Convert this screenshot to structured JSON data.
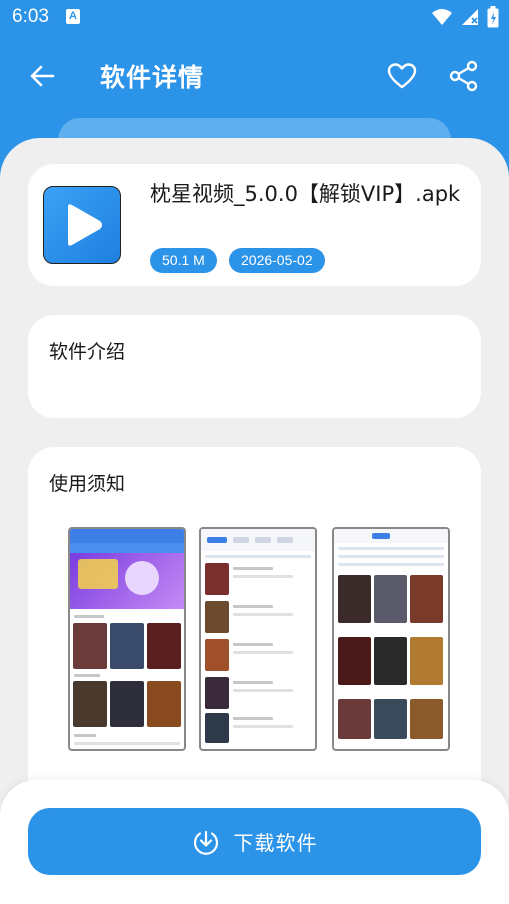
{
  "status_bar": {
    "time": "6:03",
    "notification_glyph": "A"
  },
  "app_bar": {
    "title": "软件详情"
  },
  "app": {
    "name": "枕星视频_5.0.0【解锁VIP】.apk",
    "size": "50.1 M",
    "date": "2026-05-02"
  },
  "intro": {
    "heading": "软件介绍"
  },
  "notice": {
    "heading": "使用须知"
  },
  "download": {
    "label": "下载软件"
  },
  "colors": {
    "primary": "#2b93e8",
    "sheet": "#efefef",
    "card": "#ffffff"
  },
  "icons": [
    "back-arrow-icon",
    "heart-icon",
    "share-icon",
    "download-icon",
    "wifi-icon",
    "signal-icon",
    "battery-icon",
    "play-icon"
  ]
}
